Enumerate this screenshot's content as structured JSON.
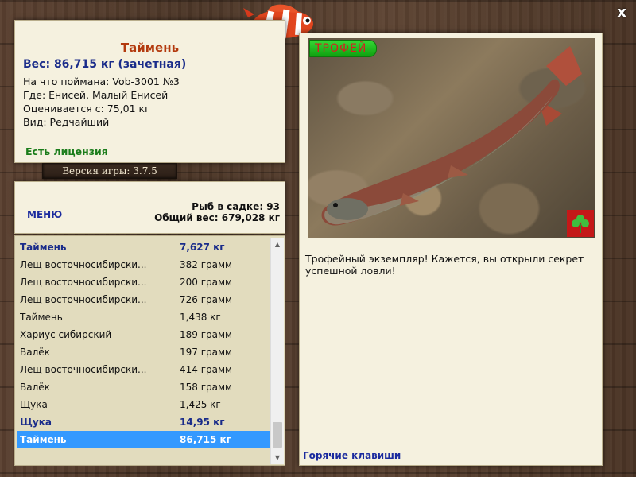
{
  "fish": {
    "name": "Таймень",
    "weight": "Вес: 86,715 кг (зачетная)",
    "caught_on": "На что поймана: Vob-3001 №3",
    "where": "Где: Енисей, Малый Енисей",
    "rated_from": "Оценивается с: 75,01 кг",
    "kind": "Вид: Редчайший",
    "license": "Есть лицензия"
  },
  "game_version": "Версия игры: 3.7.5",
  "menu_label": "МЕНЮ",
  "keepnet": {
    "count": "Рыб в садке: 93",
    "total_weight": "Общий вес: 679,028 кг"
  },
  "catch_list": [
    {
      "name": "Таймень",
      "weight": "7,627 кг",
      "style": "bold"
    },
    {
      "name": "Лещ восточносибирски...",
      "weight": "382 грамм",
      "style": ""
    },
    {
      "name": "Лещ восточносибирски...",
      "weight": "200 грамм",
      "style": ""
    },
    {
      "name": "Лещ восточносибирски...",
      "weight": "726 грамм",
      "style": ""
    },
    {
      "name": "Таймень",
      "weight": "1,438 кг",
      "style": ""
    },
    {
      "name": "Хариус сибирский",
      "weight": "189 грамм",
      "style": ""
    },
    {
      "name": "Валёк",
      "weight": "197 грамм",
      "style": ""
    },
    {
      "name": "Лещ восточносибирски...",
      "weight": "414 грамм",
      "style": ""
    },
    {
      "name": "Валёк",
      "weight": "158 грамм",
      "style": ""
    },
    {
      "name": "Щука",
      "weight": "1,425 кг",
      "style": ""
    },
    {
      "name": "Щука",
      "weight": "14,95 кг",
      "style": "bold"
    },
    {
      "name": "Таймень",
      "weight": "86,715 кг",
      "style": "selected"
    }
  ],
  "trophy_badge": "ТРОФЕЙ",
  "trophy_message": "Трофейный экземпляр! Кажется, вы открыли секрет успешной ловли!",
  "hotkeys_link": "Горячие клавиши",
  "close_symbol": "x",
  "icons": {
    "logo": "clownfish-logo-icon",
    "clover": "clover-icon",
    "close": "close-icon"
  },
  "colors": {
    "panel_bg": "#f5f1df",
    "list_bg": "#e2dcbe",
    "selected_row": "#3399ff",
    "title": "#b33a0e",
    "accent_blue": "#1a2c8a",
    "license_green": "#1b7d1b"
  }
}
